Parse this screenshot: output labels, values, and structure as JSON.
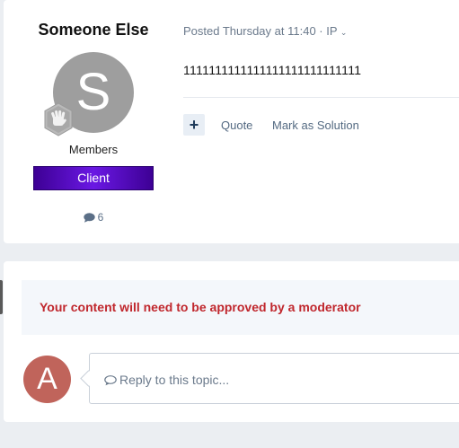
{
  "post": {
    "author_name": "Someone Else",
    "avatar_letter": "S",
    "avatar_color": "#9e9e9e",
    "rank_icon": "hand-wave-badge-icon",
    "group": "Members",
    "badge_label": "Client",
    "badge_color": "#5a12c9",
    "post_count": "6",
    "meta_text": "Posted Thursday at 11:40 · IP",
    "content": "1111111111111111111111111111",
    "actions": {
      "multiquote_label": "+",
      "quote_label": "Quote",
      "solution_label": "Mark as Solution"
    }
  },
  "reply": {
    "notice": "Your content will need to be approved by a moderator",
    "notice_color": "#c0272d",
    "avatar_letter": "A",
    "avatar_color": "#c0645b",
    "placeholder": "Reply to this topic..."
  }
}
